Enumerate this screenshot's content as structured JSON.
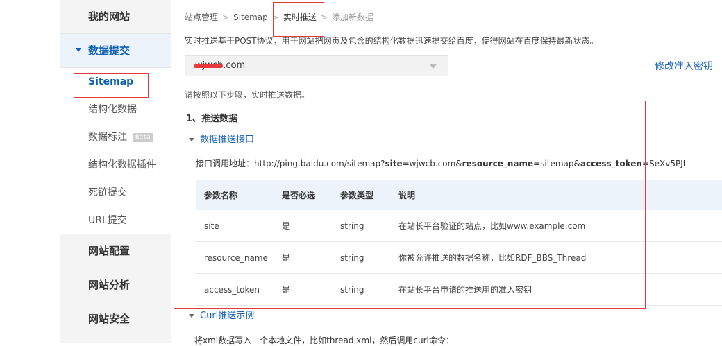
{
  "sidebar": {
    "groups": [
      {
        "label": "我的网站"
      },
      {
        "label": "数据提交"
      },
      {
        "label": "网站配置"
      },
      {
        "label": "网站分析"
      },
      {
        "label": "网站安全"
      }
    ],
    "sub_items": [
      {
        "label": "Sitemap"
      },
      {
        "label": "结构化数据"
      },
      {
        "label": "数据标注",
        "badge": "Beta"
      },
      {
        "label": "结构化数据插件"
      },
      {
        "label": "死链提交"
      },
      {
        "label": "URL提交"
      }
    ]
  },
  "breadcrumb": {
    "items": [
      "站点管理",
      "Sitemap",
      "实时推送",
      "添加新数据"
    ],
    "separator": ">"
  },
  "description": "实时推送基于POST协议，用于网站把网页及包含的结构化数据迅速提交给百度，使得网站在百度保持最新状态。",
  "site_select": {
    "value": "wjwcb.com"
  },
  "modify_link": "修改准入密钥",
  "steps_intro": "请按照以下步骤，实时推送数据。",
  "step1": {
    "title": "1、推送数据",
    "section1_title": "数据推送接口",
    "api_label": "接口调用地址：",
    "api_url": {
      "prefix": "http://ping.baidu.com/sitemap?",
      "k1": "site",
      "v1": "=wjwcb.com&",
      "k2": "resource_name",
      "v2": "=sitemap&",
      "k3": "access_token",
      "v3": "=SeXv5PJI"
    },
    "table": {
      "headers": [
        "参数名称",
        "是否必选",
        "参数类型",
        "说明"
      ],
      "rows": [
        [
          "site",
          "是",
          "string",
          "在站长平台验证的站点，比如www.example.com"
        ],
        [
          "resource_name",
          "是",
          "string",
          "你被允许推送的数据名称，比如RDF_BBS_Thread"
        ],
        [
          "access_token",
          "是",
          "string",
          "在站长平台申请的推送用的准入密钥"
        ]
      ]
    },
    "section2_title": "Curl推送示例",
    "section2_text": "将xml数据写入一个本地文件，比如thread.xml，然后调用curl命令："
  },
  "colors": {
    "accent": "#1a65b8",
    "highlight": "#e0393e",
    "sidebar_bg": "#f4f4f4"
  }
}
